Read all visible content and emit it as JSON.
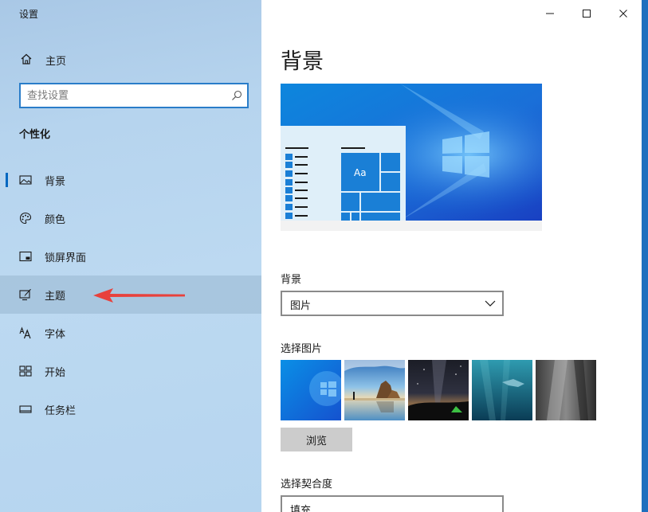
{
  "window": {
    "title": "设置",
    "controls": [
      "minimize-icon",
      "maximize-icon",
      "close-icon"
    ]
  },
  "sidebar": {
    "home_label": "主页",
    "search_placeholder": "查找设置",
    "section_title": "个性化",
    "items": [
      {
        "label": "背景",
        "icon": "image-icon",
        "selected": true
      },
      {
        "label": "颜色",
        "icon": "palette-icon",
        "selected": false
      },
      {
        "label": "锁屏界面",
        "icon": "lock-screen-icon",
        "selected": false
      },
      {
        "label": "主题",
        "icon": "theme-brush-icon",
        "selected": false,
        "hovered": true
      },
      {
        "label": "字体",
        "icon": "font-icon",
        "selected": false
      },
      {
        "label": "开始",
        "icon": "start-grid-icon",
        "selected": false
      },
      {
        "label": "任务栏",
        "icon": "taskbar-icon",
        "selected": false
      }
    ]
  },
  "main": {
    "page_title": "背景",
    "preview_tile_text": "Aa",
    "background_label": "背景",
    "background_value": "图片",
    "choose_picture_label": "选择图片",
    "browse_label": "浏览",
    "fit_label": "选择契合度",
    "fit_value": "填充"
  },
  "colors": {
    "accent": "#0067c0",
    "search_border": "#2a7dc9",
    "annotation_arrow": "#e8413c"
  }
}
